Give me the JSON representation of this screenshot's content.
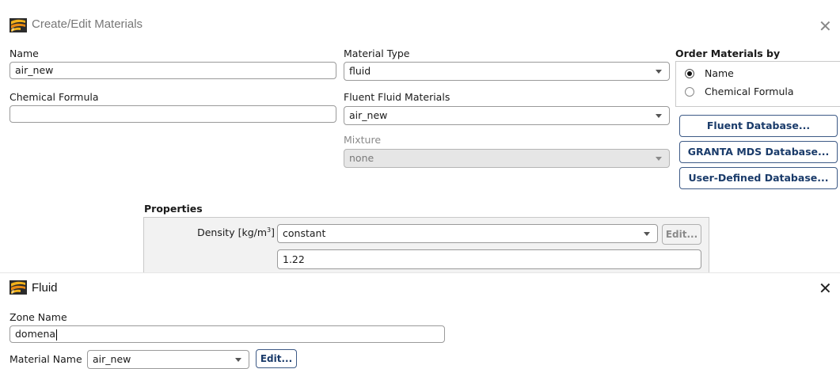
{
  "materials_window": {
    "title": "Create/Edit Materials",
    "name_label": "Name",
    "name_value": "air_new",
    "chemical_formula_label": "Chemical Formula",
    "chemical_formula_value": "",
    "material_type_label": "Material Type",
    "material_type_value": "fluid",
    "fluent_fluid_materials_label": "Fluent Fluid Materials",
    "fluent_fluid_materials_value": "air_new",
    "mixture_label": "Mixture",
    "mixture_value": "none",
    "order_by": {
      "title": "Order Materials by",
      "options": [
        {
          "label": "Name",
          "selected": true
        },
        {
          "label": "Chemical Formula",
          "selected": false
        }
      ]
    },
    "buttons": {
      "fluent_database": "Fluent Database...",
      "granta_mds_database": "GRANTA MDS Database...",
      "user_defined_database": "User-Defined Database..."
    },
    "properties": {
      "title": "Properties",
      "density_label": "Density [kg/m",
      "density_unit_sup": "3",
      "density_label_end": "]",
      "density_method": "constant",
      "density_edit": "Edit...",
      "density_value": "1.22"
    }
  },
  "fluid_window": {
    "title": "Fluid",
    "zone_name_label": "Zone Name",
    "zone_name_value": "domena",
    "material_name_label": "Material Name",
    "material_name_value": "air_new",
    "edit_button": "Edit..."
  },
  "icons": {
    "app_logo": "fluent-logo-icon",
    "close": "close-icon",
    "dropdown": "chevron-down-icon"
  }
}
